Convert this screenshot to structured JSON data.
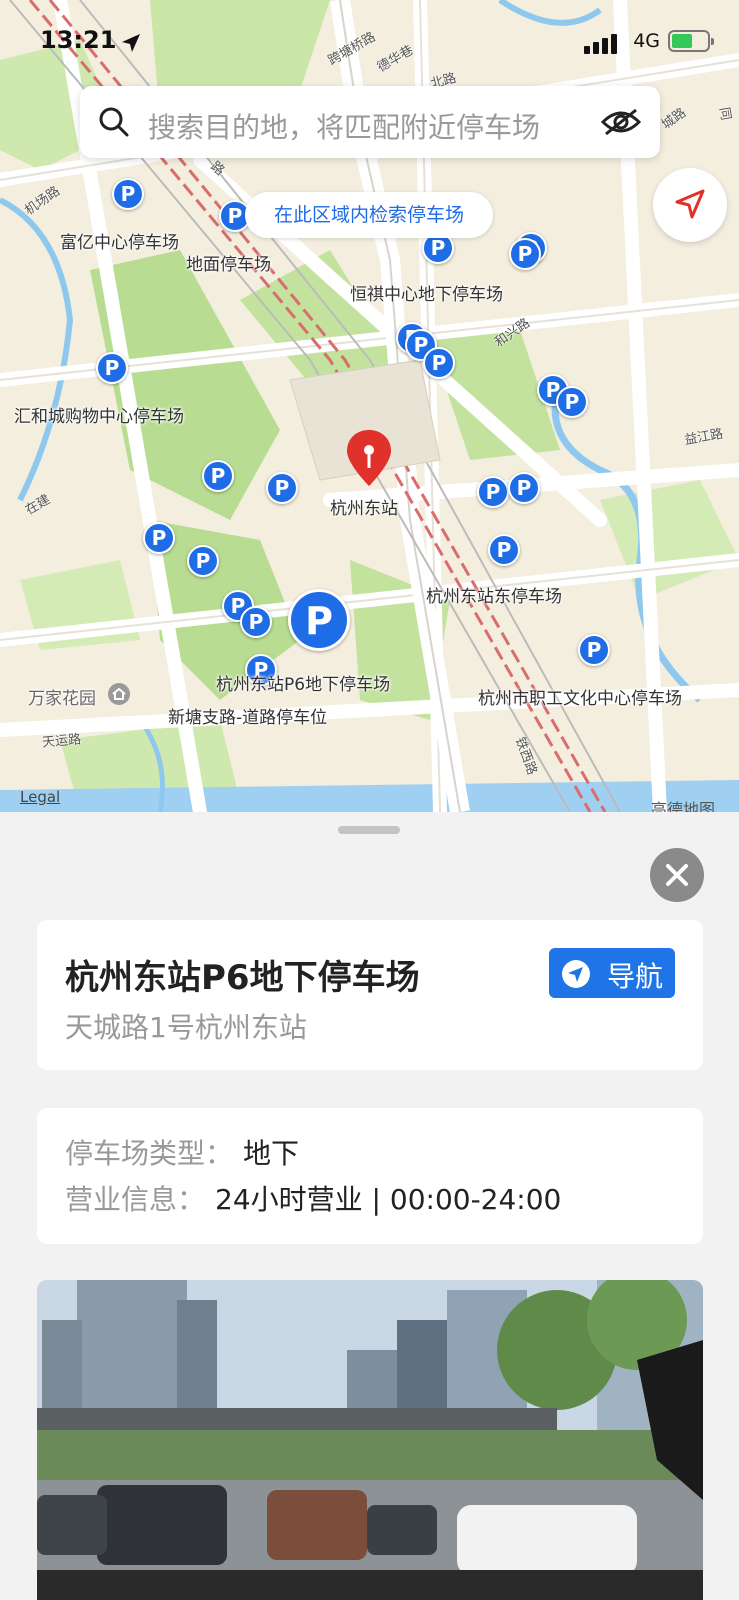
{
  "status_bar": {
    "time": "13:21",
    "network": "4G"
  },
  "search": {
    "placeholder": "搜索目的地，将匹配附近停车场"
  },
  "map": {
    "area_search_label": "在此区域内检索停车场",
    "pin_glyph": "P",
    "destination_label": "杭州东站",
    "parking_labels": [
      "富亿中心停车场",
      "地面停车场",
      "恒祺中心地下停车场",
      "汇和城购物中心停车场",
      "杭州东站东停车场",
      "杭州东站P6地下停车场",
      "杭州市职工文化中心停车场",
      "新塘支路-道路停车位"
    ],
    "poi_label": "万家花园",
    "road_labels": [
      "机场路",
      "跨塘桥路",
      "德华巷",
      "北路",
      "城路",
      "同",
      "和兴路",
      "益江路",
      "在建",
      "天运路",
      "铁西路",
      "路"
    ],
    "legal": "Legal",
    "attribution": "高德地图"
  },
  "detail": {
    "title": "杭州东站P6地下停车场",
    "address": "天城路1号杭州东站",
    "nav_label": "导航",
    "type_label": "停车场类型：",
    "type_value": "地下",
    "hours_label": "营业信息：",
    "hours_value": "24小时营业 | 00:00-24:00"
  },
  "colors": {
    "accent": "#1f6de6",
    "nav_button": "#1f74e8",
    "marker_red": "#e0322b",
    "battery": "#34c759"
  }
}
